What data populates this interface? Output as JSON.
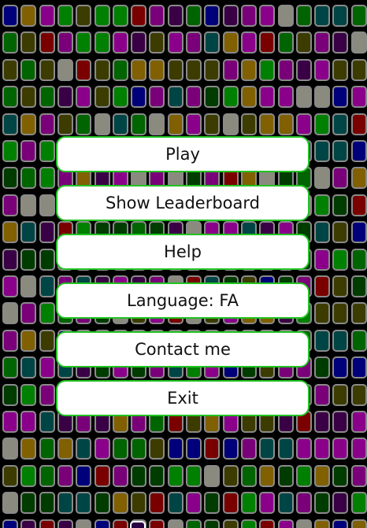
{
  "palette": [
    "#00007a",
    "#7a007a",
    "#006400",
    "#004545",
    "#3c3c00",
    "#3a0046",
    "#8a8a7e",
    "#7a0000",
    "#806000",
    "#008000",
    "#003c00",
    "#8b008b"
  ],
  "menu": {
    "items": [
      {
        "key": "play",
        "label": "Play"
      },
      {
        "key": "leaderboard",
        "label": "Show Leaderboard"
      },
      {
        "key": "help",
        "label": "Help"
      },
      {
        "key": "language",
        "label": "Language: FA"
      },
      {
        "key": "contact",
        "label": "Contact me"
      },
      {
        "key": "exit",
        "label": "Exit"
      }
    ]
  }
}
